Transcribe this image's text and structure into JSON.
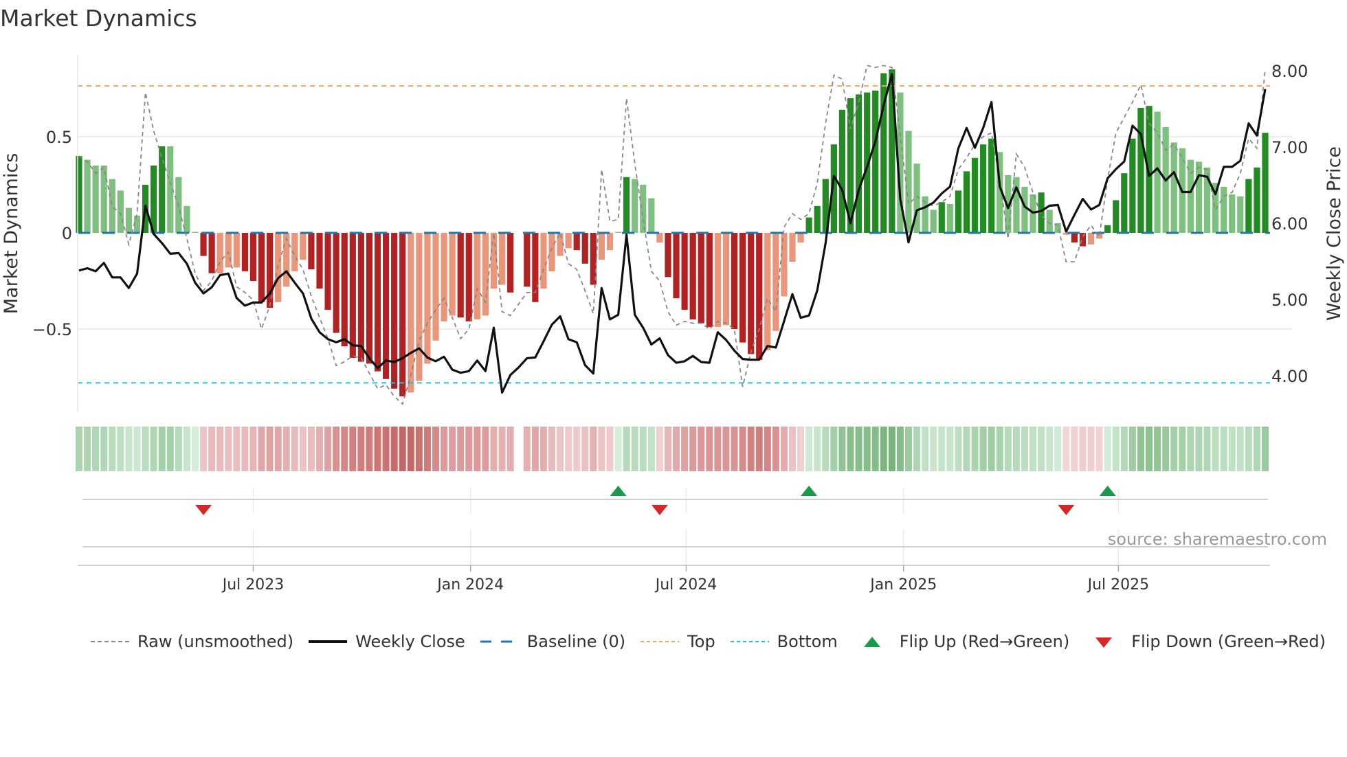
{
  "title": "Market Dynamics",
  "source": "source: sharemaestro.com",
  "colors": {
    "strong_green": "#228b22",
    "weak_green": "#7fbf7f",
    "strong_red": "#b22222",
    "weak_red": "#e9967a",
    "raw": "#888888",
    "close": "#111111",
    "baseline": "#1f77b4",
    "top": "#f4a460",
    "bottom": "#22c5d8",
    "flip_up": "#1a9a4a",
    "flip_down": "#d62728"
  },
  "legend": [
    {
      "key": "raw",
      "label": "Raw (unsmoothed)"
    },
    {
      "key": "close",
      "label": "Weekly Close"
    },
    {
      "key": "baseline",
      "label": "Baseline (0)"
    },
    {
      "key": "top",
      "label": "Top"
    },
    {
      "key": "bottom",
      "label": "Bottom"
    },
    {
      "key": "flip_up",
      "label": "Flip Up (Red→Green)"
    },
    {
      "key": "flip_down",
      "label": "Flip Down (Green→Red)"
    }
  ],
  "chart_data": {
    "type": "bar",
    "title": "Market Dynamics",
    "ylabel": "Market Dynamics",
    "y2label": "Weekly Close Price",
    "frequency": "weekly",
    "start_week": "2023-02-04",
    "ylim": [
      -0.93,
      0.93
    ],
    "y2lim": [
      3.4,
      8.1
    ],
    "yticks": [
      {
        "v": 0.5,
        "label": "0.5"
      },
      {
        "v": 0,
        "label": "0"
      },
      {
        "v": -0.5,
        "label": "−0.5"
      }
    ],
    "y2ticks": [
      {
        "v": 8,
        "label": "8.00"
      },
      {
        "v": 7,
        "label": "7.00"
      },
      {
        "v": 6,
        "label": "6.00"
      },
      {
        "v": 5,
        "label": "5.00"
      },
      {
        "v": 4,
        "label": "4.00"
      }
    ],
    "xticks": [
      {
        "week": 21,
        "label": "Jul 2023"
      },
      {
        "week": 47.2,
        "label": "Jan 2024"
      },
      {
        "week": 73.2,
        "label": "Jul 2024"
      },
      {
        "week": 99.4,
        "label": "Jan 2025"
      },
      {
        "week": 125.3,
        "label": "Jul 2025"
      }
    ],
    "top_level": 0.764,
    "bottom_level": -0.78,
    "baseline": 0,
    "grid": true,
    "legend_placement": "bottom",
    "market_dynamics": [
      0.4,
      0.38,
      0.35,
      0.35,
      0.28,
      0.22,
      0.13,
      0.09,
      0.25,
      0.35,
      0.45,
      0.45,
      0.29,
      0.14,
      0.005,
      -0.12,
      -0.21,
      -0.21,
      -0.18,
      -0.18,
      -0.2,
      -0.25,
      -0.36,
      -0.39,
      -0.36,
      -0.28,
      -0.2,
      -0.14,
      -0.19,
      -0.29,
      -0.4,
      -0.52,
      -0.59,
      -0.65,
      -0.67,
      -0.68,
      -0.72,
      -0.76,
      -0.81,
      -0.85,
      -0.83,
      -0.77,
      -0.68,
      -0.56,
      -0.46,
      -0.43,
      -0.44,
      -0.46,
      -0.45,
      -0.43,
      -0.29,
      -0.27,
      -0.31,
      null,
      -0.28,
      -0.36,
      -0.29,
      -0.2,
      -0.12,
      -0.08,
      -0.09,
      -0.16,
      -0.27,
      -0.14,
      -0.09,
      0.005,
      0.29,
      0.28,
      0.25,
      0.18,
      -0.05,
      -0.23,
      -0.34,
      -0.4,
      -0.45,
      -0.47,
      -0.49,
      -0.49,
      -0.48,
      -0.5,
      -0.57,
      -0.63,
      -0.66,
      -0.61,
      -0.51,
      -0.33,
      -0.15,
      -0.05,
      0.08,
      0.14,
      0.28,
      0.46,
      0.64,
      0.7,
      0.72,
      0.73,
      0.74,
      0.83,
      0.85,
      0.73,
      0.53,
      0.36,
      0.19,
      0.12,
      0.16,
      0.15,
      0.22,
      0.32,
      0.39,
      0.46,
      0.49,
      0.42,
      0.3,
      0.29,
      0.24,
      0.2,
      0.21,
      0.12,
      0.05,
      -0.01,
      -0.05,
      -0.07,
      -0.06,
      -0.03,
      0.04,
      0.17,
      0.31,
      0.49,
      0.65,
      0.66,
      0.63,
      0.55,
      0.47,
      0.44,
      0.38,
      0.37,
      0.34,
      0.26,
      0.24,
      0.2,
      0.19,
      0.28,
      0.34,
      0.52
    ],
    "raw": [
      0.4,
      0.37,
      0.31,
      0.34,
      0.14,
      0.1,
      -0.06,
      0.1,
      0.73,
      0.53,
      0.39,
      0.26,
      0.14,
      -0.03,
      -0.21,
      -0.3,
      -0.25,
      -0.15,
      -0.1,
      -0.28,
      -0.31,
      -0.35,
      -0.5,
      -0.38,
      -0.17,
      -0.03,
      -0.12,
      -0.19,
      -0.33,
      -0.44,
      -0.55,
      -0.69,
      -0.67,
      -0.64,
      -0.65,
      -0.73,
      -0.81,
      -0.79,
      -0.85,
      -0.89,
      -0.74,
      -0.56,
      -0.47,
      -0.4,
      -0.34,
      -0.44,
      -0.55,
      -0.5,
      -0.29,
      -0.36,
      0.0,
      -0.41,
      -0.43,
      -0.37,
      -0.31,
      -0.31,
      -0.19,
      -0.08,
      0.0,
      -0.16,
      -0.19,
      -0.3,
      -0.42,
      0.33,
      0.06,
      0.07,
      0.7,
      0.36,
      0.07,
      -0.2,
      -0.25,
      -0.41,
      -0.48,
      -0.46,
      -0.47,
      -0.47,
      -0.5,
      -0.46,
      -0.47,
      -0.5,
      -0.8,
      -0.62,
      -0.5,
      -0.34,
      -0.41,
      0.03,
      0.1,
      0.07,
      0.1,
      0.26,
      0.57,
      0.82,
      0.8,
      0.54,
      0.68,
      0.87,
      0.86,
      0.87,
      0.86,
      0.51,
      0.15,
      0.19,
      0.16,
      0.14,
      0.16,
      0.19,
      0.33,
      0.39,
      0.46,
      0.5,
      0.52,
      0.27,
      -0.03,
      0.41,
      0.34,
      0.21,
      0.09,
      0.05,
      0.04,
      -0.15,
      -0.15,
      -0.02,
      0.04,
      -0.02,
      0.28,
      0.52,
      0.6,
      0.68,
      0.77,
      0.57,
      0.52,
      0.43,
      0.46,
      0.39,
      0.31,
      0.34,
      0.33,
      0.12,
      0.19,
      0.21,
      0.31,
      0.49,
      0.44,
      0.85
    ],
    "weekly_close": [
      5.38,
      5.41,
      5.37,
      5.48,
      5.29,
      5.29,
      5.15,
      5.34,
      6.23,
      5.86,
      5.74,
      5.6,
      5.61,
      5.47,
      5.22,
      5.08,
      5.16,
      5.32,
      5.34,
      5.02,
      4.92,
      4.96,
      4.96,
      5.08,
      5.28,
      5.37,
      5.22,
      5.08,
      4.75,
      4.57,
      4.48,
      4.44,
      4.48,
      4.4,
      4.39,
      4.23,
      4.1,
      4.2,
      4.18,
      4.23,
      4.3,
      4.36,
      4.24,
      4.19,
      4.25,
      4.08,
      4.04,
      4.06,
      4.2,
      4.06,
      4.63,
      3.78,
      4.01,
      4.11,
      4.23,
      4.24,
      4.45,
      4.67,
      4.78,
      4.48,
      4.44,
      4.14,
      4.03,
      5.15,
      4.74,
      4.8,
      5.85,
      4.8,
      4.63,
      4.41,
      4.49,
      4.27,
      4.17,
      4.19,
      4.26,
      4.18,
      4.17,
      4.57,
      4.47,
      4.33,
      4.22,
      4.21,
      4.21,
      4.39,
      4.37,
      4.72,
      5.07,
      4.76,
      4.79,
      5.12,
      5.74,
      6.62,
      6.44,
      6.0,
      6.44,
      6.74,
      7.07,
      7.55,
      7.96,
      6.32,
      5.75,
      6.17,
      6.21,
      6.27,
      6.39,
      6.48,
      6.98,
      7.25,
      6.99,
      7.25,
      7.59,
      6.48,
      6.2,
      6.47,
      6.22,
      6.14,
      6.16,
      6.23,
      6.24,
      5.89,
      6.11,
      6.32,
      6.18,
      6.24,
      6.59,
      6.71,
      6.81,
      7.28,
      7.17,
      6.62,
      6.72,
      6.56,
      6.67,
      6.41,
      6.41,
      6.63,
      6.61,
      6.38,
      6.74,
      6.74,
      6.82,
      7.31,
      7.15,
      7.76
    ],
    "flips": [
      {
        "date": "2023-05-20",
        "direction": "down"
      },
      {
        "date": "2024-05-04",
        "direction": "up"
      },
      {
        "date": "2024-06-08",
        "direction": "down"
      },
      {
        "date": "2024-10-12",
        "direction": "up"
      },
      {
        "date": "2025-05-17",
        "direction": "down"
      },
      {
        "date": "2025-06-21",
        "direction": "up"
      }
    ]
  }
}
